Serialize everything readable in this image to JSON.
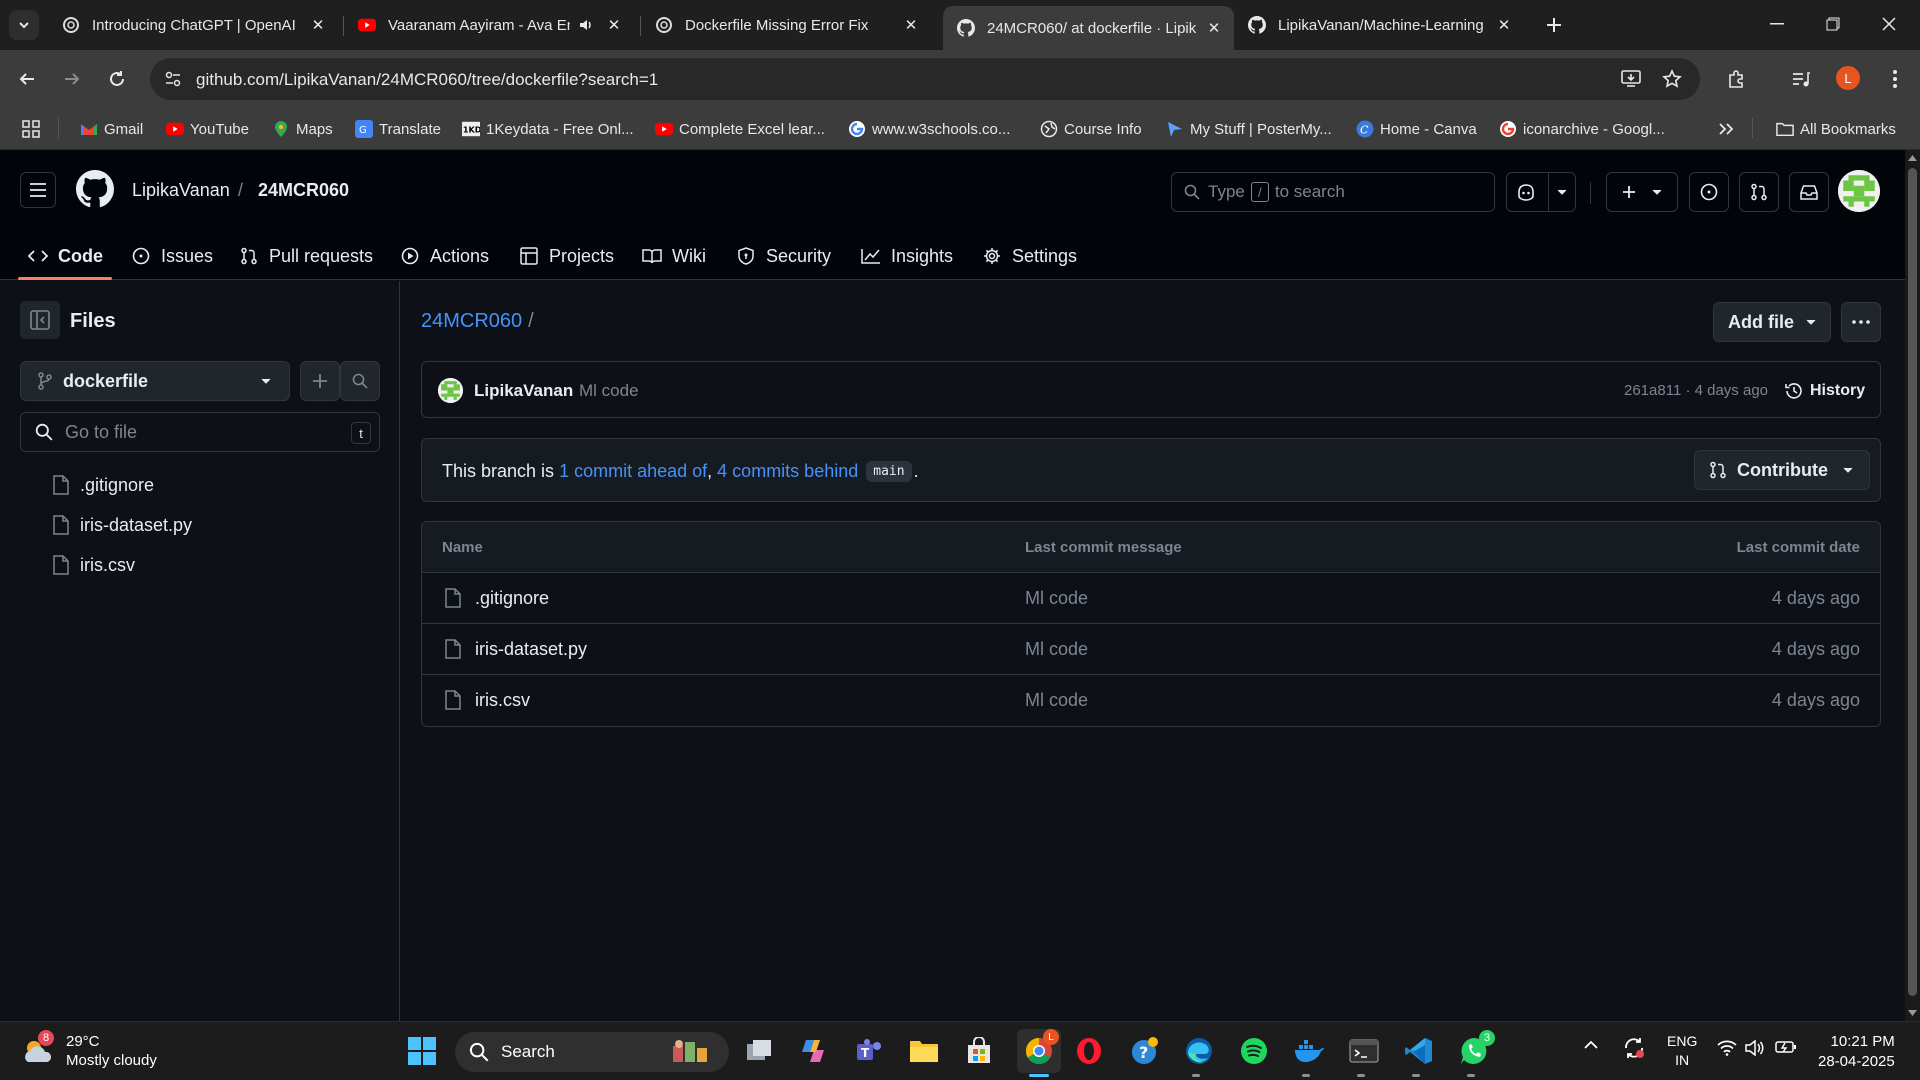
{
  "browser": {
    "tabs": [
      {
        "title": "Introducing ChatGPT | OpenAI",
        "icon": "openai-icon"
      },
      {
        "title": "Vaaranam Aayiram - Ava En",
        "icon": "youtube-icon"
      },
      {
        "title": "Dockerfile Missing Error Fix",
        "icon": "openai-icon"
      },
      {
        "title": "24MCR060/ at dockerfile · Lipik",
        "icon": "github-icon"
      },
      {
        "title": "LipikaVanan/Machine-Learning",
        "icon": "github-icon"
      }
    ],
    "active_tab": 3,
    "url": "github.com/LipikaVanan/24MCR060/tree/dockerfile?search=1",
    "profile_letter": "L",
    "bookmarks": [
      "Gmail",
      "YouTube",
      "Maps",
      "Translate",
      "1Keydata - Free Onl...",
      "Complete Excel lear...",
      "www.w3schools.co...",
      "Course Info",
      "My Stuff | PosterMy...",
      "Home - Canva",
      "iconarchive - Googl..."
    ],
    "all_bookmarks": "All Bookmarks"
  },
  "github": {
    "owner": "LipikaVanan",
    "separator": "/",
    "repo": "24MCR060",
    "search_prefix": "Type",
    "search_key": "/",
    "search_suffix": "to search",
    "nav": [
      "Code",
      "Issues",
      "Pull requests",
      "Actions",
      "Projects",
      "Wiki",
      "Security",
      "Insights",
      "Settings"
    ],
    "active_nav": "Code"
  },
  "sidebar": {
    "title": "Files",
    "branch": "dockerfile",
    "goto_placeholder": "Go to file",
    "goto_key": "t",
    "files": [
      ".gitignore",
      "iris-dataset.py",
      "iris.csv"
    ]
  },
  "main": {
    "breadcrumb_repo": "24MCR060",
    "breadcrumb_sep": "/",
    "add_file": "Add file",
    "commit": {
      "author": "LipikaVanan",
      "message": "Ml code",
      "meta": "261a811 · 4 days ago",
      "history": "History"
    },
    "ahead": {
      "prefix": "This branch is",
      "ahead_link": "1 commit ahead of",
      "comma": ",",
      "behind_link": "4 commits behind",
      "base": "main",
      "suffix": "."
    },
    "contribute": "Contribute",
    "table": {
      "headers": [
        "Name",
        "Last commit message",
        "Last commit date"
      ],
      "rows": [
        {
          "name": ".gitignore",
          "message": "Ml code",
          "date": "4 days ago"
        },
        {
          "name": "iris-dataset.py",
          "message": "Ml code",
          "date": "4 days ago"
        },
        {
          "name": "iris.csv",
          "message": "Ml code",
          "date": "4 days ago"
        }
      ]
    }
  },
  "taskbar": {
    "weather_badge": "8",
    "temperature": "29°C",
    "condition": "Mostly cloudy",
    "search_label": "Search",
    "whatsapp_badge": "3",
    "lang_top": "ENG",
    "lang_bottom": "IN",
    "time": "10:21 PM",
    "date": "28-04-2025"
  },
  "colors": {
    "accent_link": "#4493f8",
    "tab_underline": "#f78166",
    "bg": "#0d1117"
  }
}
